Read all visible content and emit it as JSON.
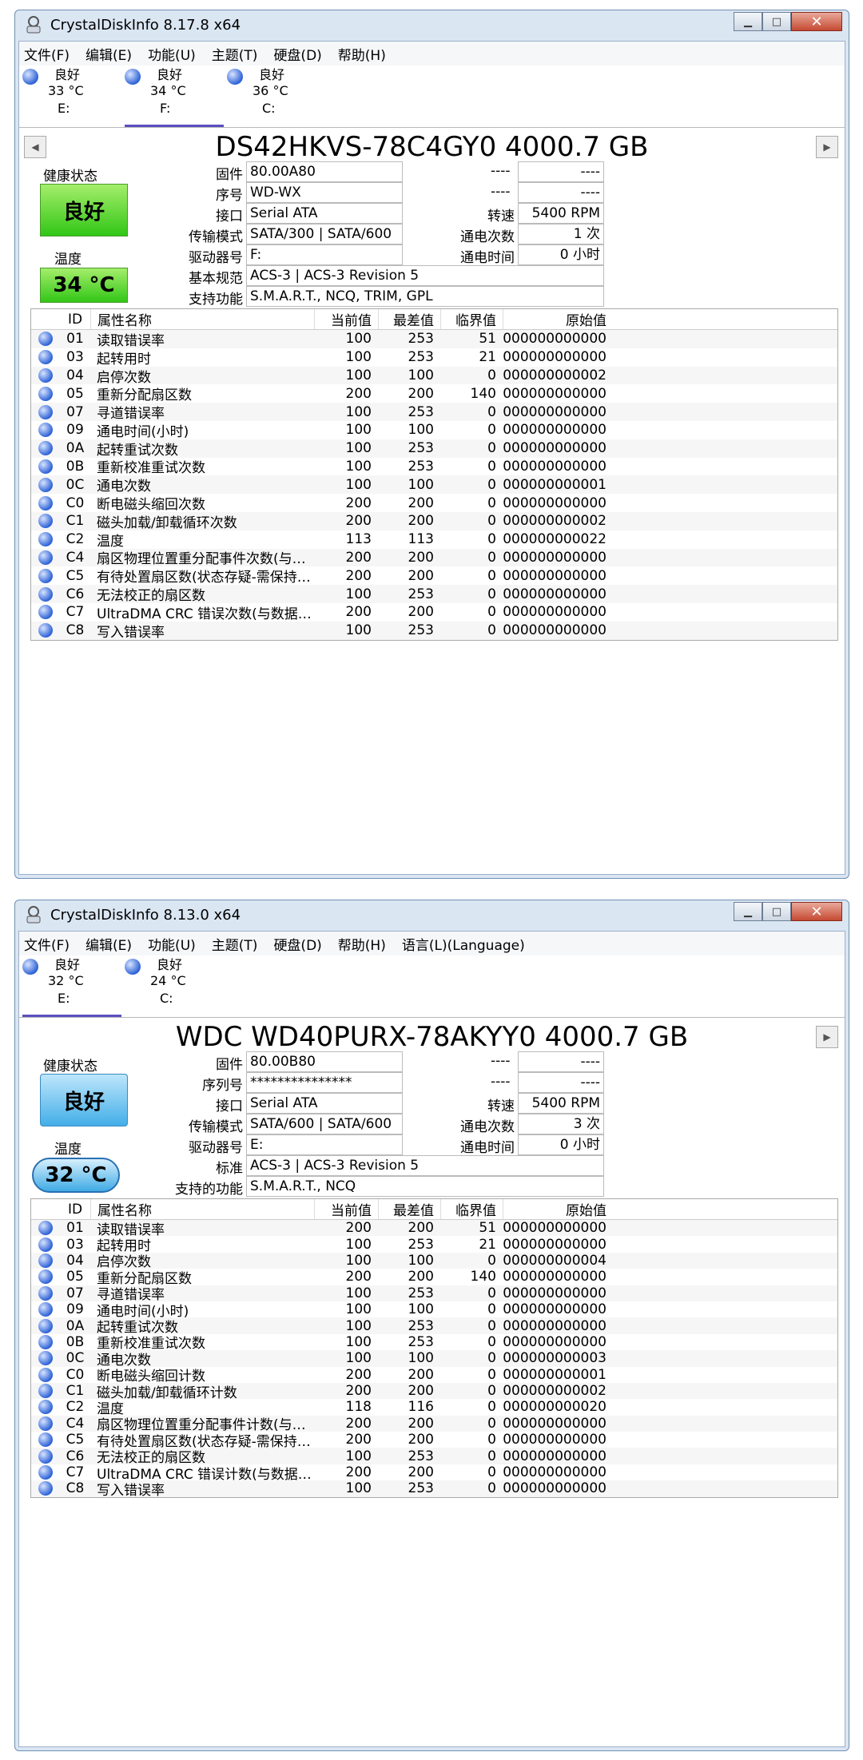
{
  "windows": [
    {
      "title": "CrystalDiskInfo 8.17.8 x64",
      "menu": [
        "文件(F)",
        "编辑(E)",
        "功能(U)",
        "主题(T)",
        "硬盘(D)",
        "帮助(H)"
      ],
      "disks": [
        {
          "status": "良好",
          "temp": "33 °C",
          "letter": "E:"
        },
        {
          "status": "良好",
          "temp": "34 °C",
          "letter": "F:"
        },
        {
          "status": "良好",
          "temp": "36 °C",
          "letter": "C:"
        }
      ],
      "model": "DS42HKVS-78C4GY0 4000.7 GB",
      "health_label": "健康状态",
      "health": "良好",
      "temp_label": "温度",
      "temp": "34 °C",
      "labels": {
        "firmware": "固件",
        "serial": "序号",
        "interface": "接口",
        "transfer": "传输模式",
        "drive": "驱动器号",
        "standard": "基本规范",
        "features": "支持功能",
        "rpm": "转速",
        "poweron_count": "通电次数",
        "poweron_hours": "通电时间"
      },
      "values": {
        "firmware": "80.00A80",
        "serial": "WD-WX",
        "interface": "Serial ATA",
        "transfer": "SATA/300 | SATA/600",
        "drive": "F:",
        "standard": "ACS-3 | ACS-3 Revision 5",
        "features": "S.M.A.R.T., NCQ, TRIM, GPL",
        "rpm": "5400 RPM",
        "poweron_count": "1 次",
        "poweron_hours": "0 小时",
        "dash": "----"
      },
      "headers": [
        "ID",
        "属性名称",
        "当前值",
        "最差值",
        "临界值",
        "原始值"
      ],
      "rows": [
        [
          "01",
          "读取错误率",
          "100",
          "253",
          "51",
          "000000000000"
        ],
        [
          "03",
          "起转用时",
          "100",
          "253",
          "21",
          "000000000000"
        ],
        [
          "04",
          "启停次数",
          "100",
          "100",
          "0",
          "000000000002"
        ],
        [
          "05",
          "重新分配扇区数",
          "200",
          "200",
          "140",
          "000000000000"
        ],
        [
          "07",
          "寻道错误率",
          "100",
          "253",
          "0",
          "000000000000"
        ],
        [
          "09",
          "通电时间(小时)",
          "100",
          "100",
          "0",
          "000000000000"
        ],
        [
          "0A",
          "起转重试次数",
          "100",
          "253",
          "0",
          "000000000000"
        ],
        [
          "0B",
          "重新校准重试次数",
          "100",
          "253",
          "0",
          "000000000000"
        ],
        [
          "0C",
          "通电次数",
          "100",
          "100",
          "0",
          "000000000001"
        ],
        [
          "C0",
          "断电磁头缩回次数",
          "200",
          "200",
          "0",
          "000000000000"
        ],
        [
          "C1",
          "磁头加载/卸载循环次数",
          "200",
          "200",
          "0",
          "000000000002"
        ],
        [
          "C2",
          "温度",
          "113",
          "113",
          "0",
          "000000000022"
        ],
        [
          "C4",
          "扇区物理位置重分配事件次数(与坏道相关)",
          "200",
          "200",
          "0",
          "000000000000"
        ],
        [
          "C5",
          "有待处置扇区数(状态存疑-需保持关注)",
          "200",
          "200",
          "0",
          "000000000000"
        ],
        [
          "C6",
          "无法校正的扇区数",
          "100",
          "253",
          "0",
          "000000000000"
        ],
        [
          "C7",
          "UltraDMA CRC 错误次数(与数据线或接口...",
          "200",
          "200",
          "0",
          "000000000000"
        ],
        [
          "C8",
          "写入错误率",
          "100",
          "253",
          "0",
          "000000000000"
        ]
      ]
    },
    {
      "title": "CrystalDiskInfo 8.13.0 x64",
      "menu": [
        "文件(F)",
        "编辑(E)",
        "功能(U)",
        "主题(T)",
        "硬盘(D)",
        "帮助(H)",
        "语言(L)(Language)"
      ],
      "disks": [
        {
          "status": "良好",
          "temp": "32 °C",
          "letter": "E:"
        },
        {
          "status": "良好",
          "temp": "24 °C",
          "letter": "C:"
        }
      ],
      "model": "WDC WD40PURX-78AKYY0 4000.7 GB",
      "health_label": "健康状态",
      "health": "良好",
      "temp_label": "温度",
      "temp": "32 °C",
      "labels": {
        "firmware": "固件",
        "serial": "序列号",
        "interface": "接口",
        "transfer": "传输模式",
        "drive": "驱动器号",
        "standard": "标准",
        "features": "支持的功能",
        "rpm": "转速",
        "poweron_count": "通电次数",
        "poweron_hours": "通电时间"
      },
      "values": {
        "firmware": "80.00B80",
        "serial": "***************",
        "interface": "Serial ATA",
        "transfer": "SATA/600 | SATA/600",
        "drive": "E:",
        "standard": "ACS-3 | ACS-3 Revision 5",
        "features": "S.M.A.R.T., NCQ",
        "rpm": "5400 RPM",
        "poweron_count": "3 次",
        "poweron_hours": "0 小时",
        "dash": "----"
      },
      "headers": [
        "ID",
        "属性名称",
        "当前值",
        "最差值",
        "临界值",
        "原始值"
      ],
      "rows": [
        [
          "01",
          "读取错误率",
          "200",
          "200",
          "51",
          "000000000000"
        ],
        [
          "03",
          "起转用时",
          "100",
          "253",
          "21",
          "000000000000"
        ],
        [
          "04",
          "启停次数",
          "100",
          "100",
          "0",
          "000000000004"
        ],
        [
          "05",
          "重新分配扇区数",
          "200",
          "200",
          "140",
          "000000000000"
        ],
        [
          "07",
          "寻道错误率",
          "100",
          "253",
          "0",
          "000000000000"
        ],
        [
          "09",
          "通电时间(小时)",
          "100",
          "100",
          "0",
          "000000000000"
        ],
        [
          "0A",
          "起转重试次数",
          "100",
          "253",
          "0",
          "000000000000"
        ],
        [
          "0B",
          "重新校准重试次数",
          "100",
          "253",
          "0",
          "000000000000"
        ],
        [
          "0C",
          "通电次数",
          "100",
          "100",
          "0",
          "000000000003"
        ],
        [
          "C0",
          "断电磁头缩回计数",
          "200",
          "200",
          "0",
          "000000000001"
        ],
        [
          "C1",
          "磁头加载/卸载循环计数",
          "200",
          "200",
          "0",
          "000000000002"
        ],
        [
          "C2",
          "温度",
          "118",
          "116",
          "0",
          "000000000020"
        ],
        [
          "C4",
          "扇区物理位置重分配事件计数(与坏道相关)",
          "200",
          "200",
          "0",
          "000000000000"
        ],
        [
          "C5",
          "有待处置扇区数(状态存疑-需保持关注)",
          "200",
          "200",
          "0",
          "000000000000"
        ],
        [
          "C6",
          "无法校正的扇区数",
          "100",
          "253",
          "0",
          "000000000000"
        ],
        [
          "C7",
          "UltraDMA CRC 错误计数(与数据线或接口相...",
          "200",
          "200",
          "0",
          "000000000000"
        ],
        [
          "C8",
          "写入错误率",
          "100",
          "253",
          "0",
          "000000000000"
        ]
      ]
    }
  ]
}
